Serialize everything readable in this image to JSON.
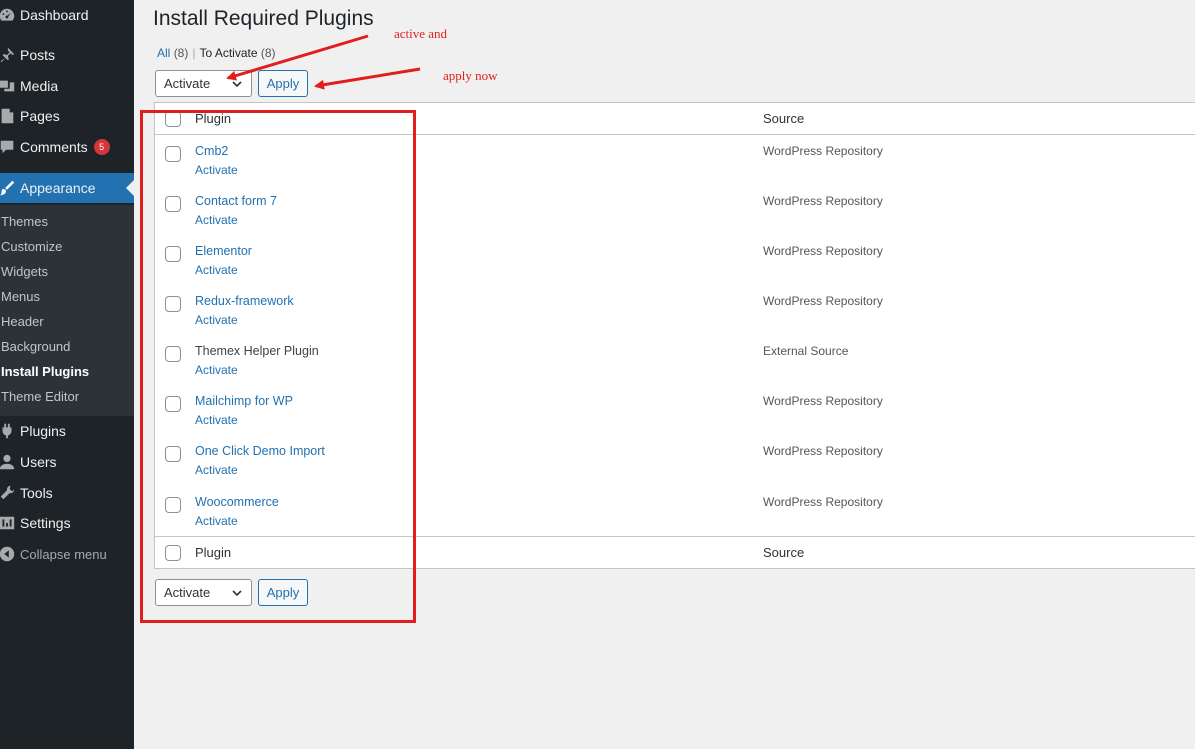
{
  "sidebar": {
    "items": [
      {
        "label": "Dashboard",
        "icon": "dashboard-icon"
      },
      {
        "label": "Posts",
        "icon": "pin-icon"
      },
      {
        "label": "Media",
        "icon": "media-icon"
      },
      {
        "label": "Pages",
        "icon": "pages-icon"
      },
      {
        "label": "Comments",
        "icon": "comment-icon",
        "badge": "5"
      },
      {
        "label": "Appearance",
        "icon": "brush-icon"
      },
      {
        "label": "Plugins",
        "icon": "plugin-icon"
      },
      {
        "label": "Users",
        "icon": "user-icon"
      },
      {
        "label": "Tools",
        "icon": "wrench-icon"
      },
      {
        "label": "Settings",
        "icon": "settings-icon"
      }
    ],
    "submenu": [
      "Themes",
      "Customize",
      "Widgets",
      "Menus",
      "Header",
      "Background",
      "Install Plugins",
      "Theme Editor"
    ],
    "collapse_label": "Collapse menu"
  },
  "page": {
    "title": "Install Required Plugins",
    "filter_all": "All",
    "filter_all_count": "(8)",
    "filter_sep": "|",
    "filter_activate": "To Activate",
    "filter_activate_count": "(8)"
  },
  "bulk": {
    "selected": "Activate",
    "apply_label": "Apply"
  },
  "table": {
    "col_plugin": "Plugin",
    "col_source": "Source",
    "rows": [
      {
        "name": "Cmb2",
        "action": "Activate",
        "source": "WordPress Repository"
      },
      {
        "name": "Contact form 7",
        "action": "Activate",
        "source": "WordPress Repository"
      },
      {
        "name": "Elementor",
        "action": "Activate",
        "source": "WordPress Repository"
      },
      {
        "name": "Redux-framework",
        "action": "Activate",
        "source": "WordPress Repository"
      },
      {
        "name": "Themex Helper Plugin",
        "action": "Activate",
        "source": "External Source"
      },
      {
        "name": "Mailchimp for WP",
        "action": "Activate",
        "source": "WordPress Repository"
      },
      {
        "name": "One Click Demo Import",
        "action": "Activate",
        "source": "WordPress Repository"
      },
      {
        "name": "Woocommerce",
        "action": "Activate",
        "source": "WordPress Repository"
      }
    ]
  },
  "annotations": {
    "note_1": "active and",
    "note_2": "apply now",
    "color": "#e01e1e"
  },
  "colors": {
    "sidebar_bg": "#1d2327",
    "accent": "#2271b1",
    "badge": "#d63638"
  }
}
